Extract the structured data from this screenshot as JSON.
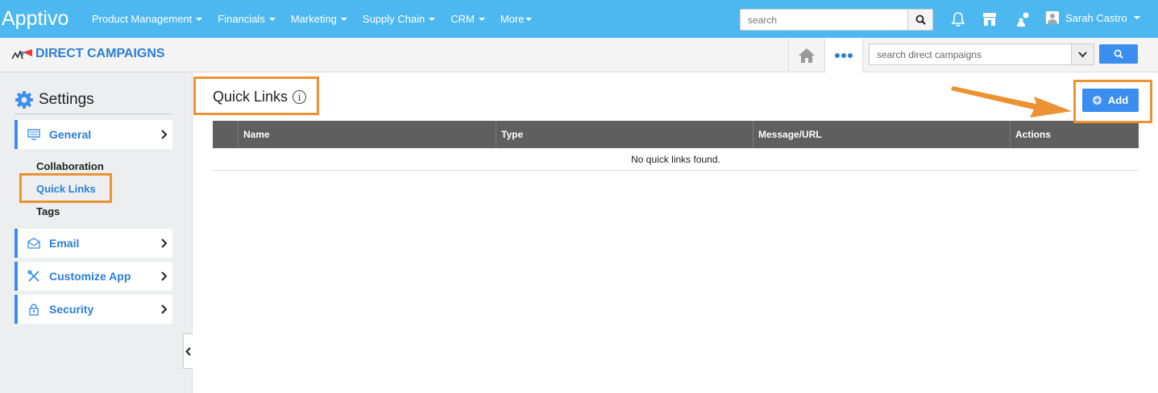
{
  "topbar": {
    "logo": "Apptivo",
    "nav": [
      {
        "label": "Product Management",
        "caret": true
      },
      {
        "label": "Financials",
        "caret": true
      },
      {
        "label": "Marketing",
        "caret": true
      },
      {
        "label": "Supply Chain",
        "caret": true
      },
      {
        "label": "CRM",
        "caret": true
      },
      {
        "label": "More",
        "caret": true
      }
    ],
    "search_placeholder": "search",
    "user_name": "Sarah Castro"
  },
  "subbar": {
    "app_title": "DIRECT CAMPAIGNS",
    "search_placeholder": "search direct campaigns"
  },
  "sidebar": {
    "title": "Settings",
    "general_label": "General",
    "sub_items": [
      "Collaboration",
      "Quick Links",
      "Tags"
    ],
    "active_sub": "Quick Links",
    "email_label": "Email",
    "customize_label": "Customize App",
    "security_label": "Security"
  },
  "main": {
    "title": "Quick Links",
    "add_label": "Add",
    "columns": [
      "",
      "Name",
      "Type",
      "Message/URL",
      "Actions"
    ],
    "empty_text": "No quick links found."
  },
  "colors": {
    "topbar": "#4db8f0",
    "accent": "#3b8ef0",
    "highlight": "#ec9233",
    "table_header": "#5f5f5f"
  }
}
